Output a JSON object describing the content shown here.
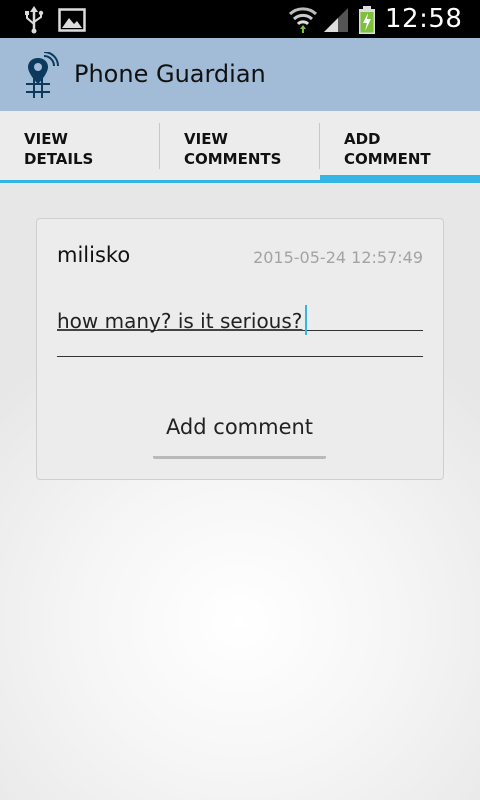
{
  "status_bar": {
    "time": "12:58",
    "icons": [
      "usb-icon",
      "gallery-icon",
      "wifi-icon",
      "signal-icon",
      "battery-charging-icon"
    ]
  },
  "app": {
    "title": "Phone Guardian",
    "icon": "phone-guardian-icon"
  },
  "tabs": [
    {
      "label": "VIEW\nDETAILS",
      "active": false
    },
    {
      "label": "VIEW\nCOMMENTS",
      "active": false
    },
    {
      "label": "ADD\nCOMMENT",
      "active": true
    }
  ],
  "comment_form": {
    "username": "milisko",
    "timestamp": "2015-05-24 12:57:49",
    "comment_value": "how many? is it serious?",
    "button_label": "Add comment"
  },
  "colors": {
    "action_bar": "#a2bcd8",
    "accent": "#33b5e5",
    "card_bg": "#ececec"
  }
}
